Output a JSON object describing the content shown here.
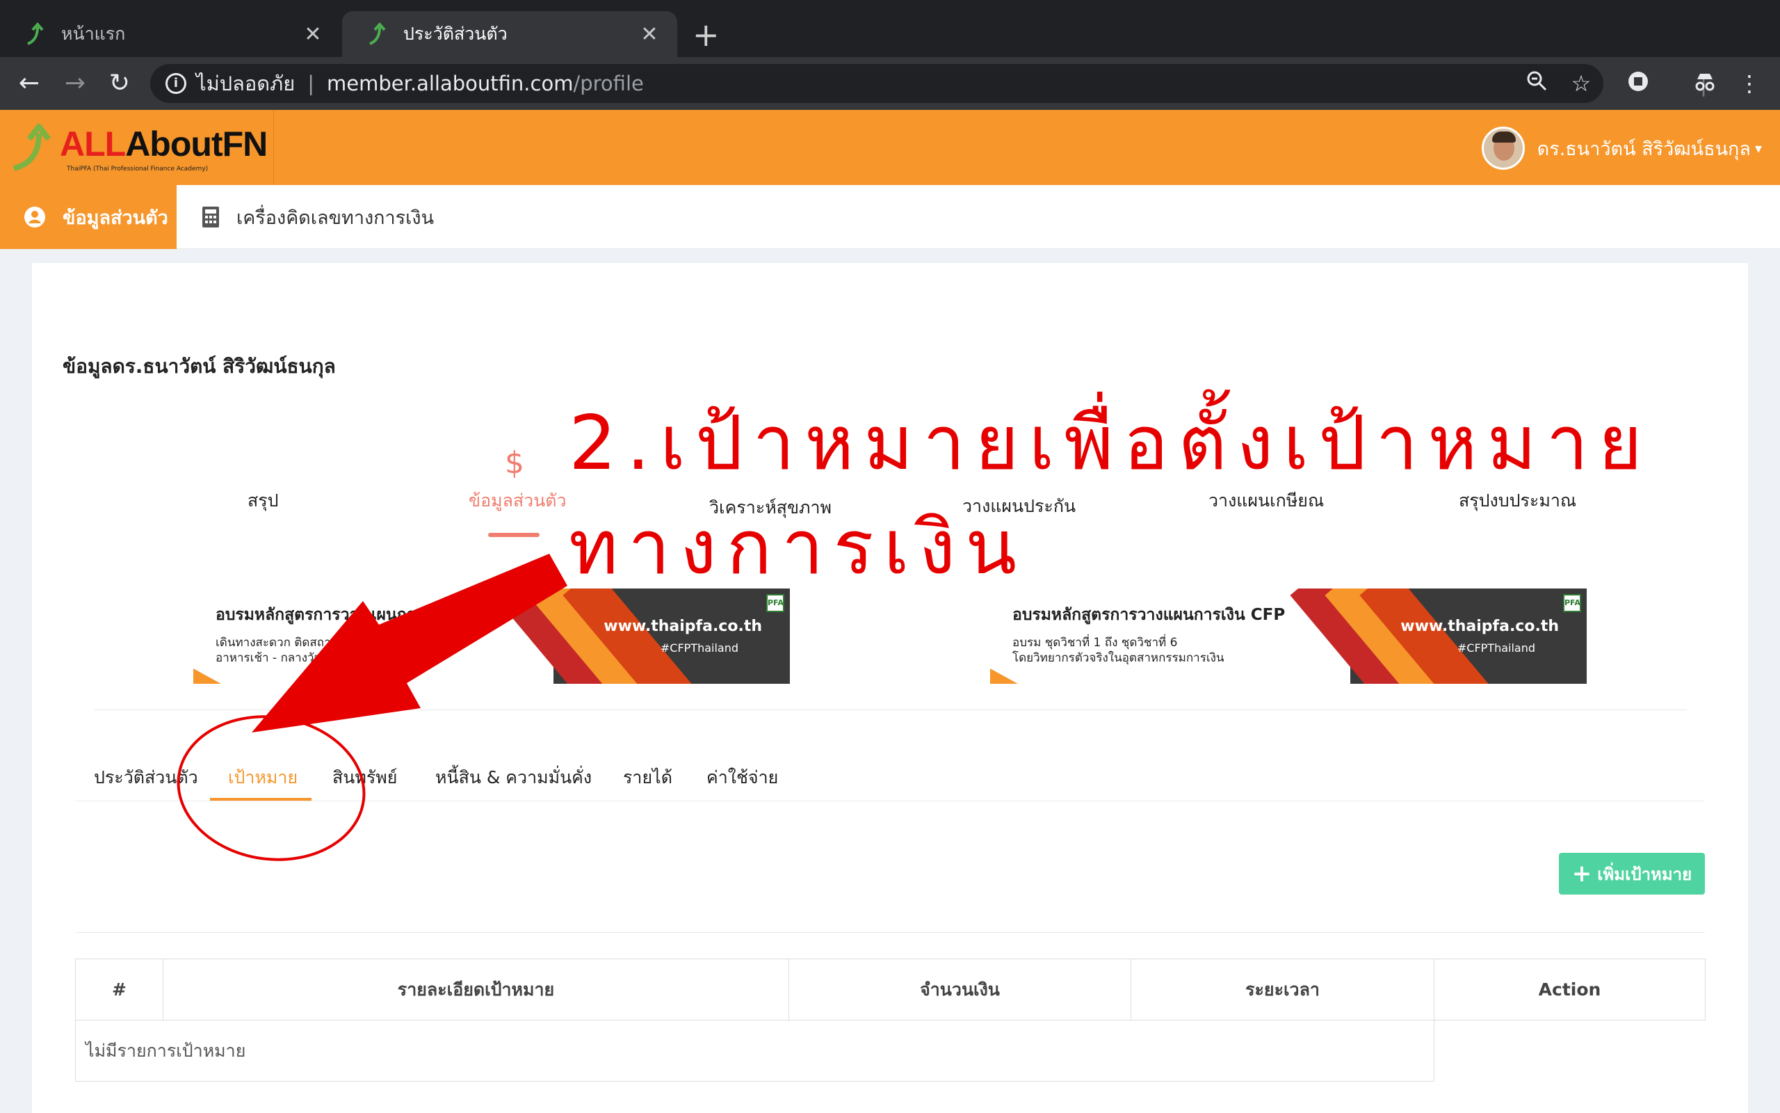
{
  "browser": {
    "tabs": [
      {
        "label": "หน้าแรก",
        "active": false
      },
      {
        "label": "ประวัติส่วนตัว",
        "active": true
      }
    ],
    "new_tab_icon": "plus-icon",
    "security_label": "ไม่ปลอดภัย",
    "url_host": "member.allaboutfin.com",
    "url_path": "/profile"
  },
  "header": {
    "logo_red": "ALL",
    "logo_dark": "AboutF",
    "logo_end": "N",
    "logo_tagline": "ThaiPFA (Thai Professional Finance Academy)",
    "user_name": "ดร.ธนาวัตน์ สิริวัฒน์ธนกุล",
    "accent_color": "#f6962b"
  },
  "nav": {
    "profile_label": "ข้อมูลส่วนตัว",
    "calculator_label": "เครื่องคิดเลขทางการเงิน"
  },
  "page": {
    "title": "ข้อมูลดร.ธนาวัตน์ สิริวัฒน์ธนกุล"
  },
  "steps": [
    {
      "label": "สรุป",
      "active": false
    },
    {
      "label": "ข้อมูลส่วนตัว",
      "active": true
    },
    {
      "label": "วิเคราะห์สุขภาพ",
      "active": false
    },
    {
      "label": "วางแผนประกัน",
      "active": false
    },
    {
      "label": "วางแผนเกษียณ",
      "active": false
    },
    {
      "label": "สรุปงบประมาณ",
      "active": false
    }
  ],
  "banners": [
    {
      "title": "อบรมหลักสูตรการวางแผนการเงิน",
      "line1": "เดินทางสะดวก ติดสถานี",
      "line2": "อาหารเช้า - กลางวัน",
      "url": "www.thaipfa.co.th",
      "hashtag": "#CFPThailand"
    },
    {
      "title": "อบรมหลักสูตรการวางแผนการเงิน CFP",
      "line1": "อบรม ชุดวิชาที่ 1 ถึง ชุดวิชาที่ 6",
      "line2": "โดยวิทยากรตัวจริงในอุตสาหกรรมการเงิน",
      "url": "www.thaipfa.co.th",
      "hashtag": "#CFPThailand"
    }
  ],
  "subtabs": [
    {
      "label": "ประวัติส่วนตัว",
      "active": false
    },
    {
      "label": "เป้าหมาย",
      "active": true
    },
    {
      "label": "สินทรัพย์",
      "active": false
    },
    {
      "label": "หนี้สิน & ความมั่นคั่ง",
      "active": false
    },
    {
      "label": "รายได้",
      "active": false
    },
    {
      "label": "ค่าใช้จ่าย",
      "active": false
    }
  ],
  "add_goal_button": "เพิ่มเป้าหมาย",
  "table": {
    "headers": [
      "#",
      "รายละเอียดเป้าหมาย",
      "จำนวนเงิน",
      "ระยะเวลา",
      "Action"
    ],
    "empty_text": "ไม่มีรายการเป้าหมาย"
  },
  "annotation": {
    "line1": "2.เป้าหมายเพื่อตั้งเป้าหมาย",
    "line2": "ทางการเงิน",
    "color": "#e60000"
  }
}
